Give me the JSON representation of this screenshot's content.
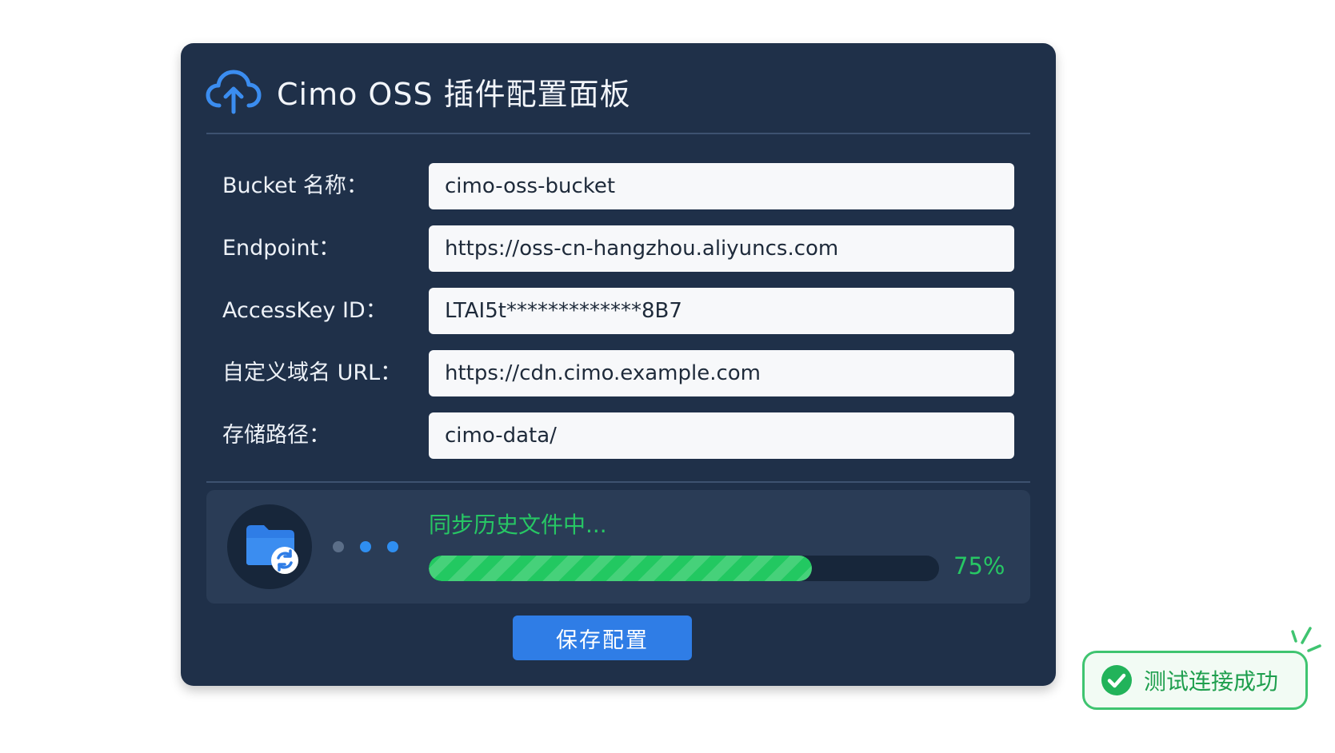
{
  "header": {
    "title": "Cimo OSS 插件配置面板",
    "icon": "cloud-upload-icon"
  },
  "form": {
    "fields": [
      {
        "label": "Bucket 名称：",
        "value": "cimo-oss-bucket"
      },
      {
        "label": "Endpoint：",
        "value": "https://oss-cn-hangzhou.aliyuncs.com"
      },
      {
        "label": "AccessKey ID：",
        "value": "LTAI5t*************8B7"
      },
      {
        "label": "自定义域名 URL：",
        "value": "https://cdn.cimo.example.com"
      },
      {
        "label": "存储路径：",
        "value": "cimo-data/"
      }
    ]
  },
  "sync": {
    "icon": "folder-sync-icon",
    "status": "同步历史文件中...",
    "progress_percent": 75,
    "progress_label": "75%"
  },
  "actions": {
    "save_label": "保存配置"
  },
  "toast": {
    "icon": "check-circle-icon",
    "message": "测试连接成功"
  },
  "colors": {
    "panel_bg": "#1f3049",
    "accent_blue": "#2f7de6",
    "success_green": "#22c861"
  }
}
